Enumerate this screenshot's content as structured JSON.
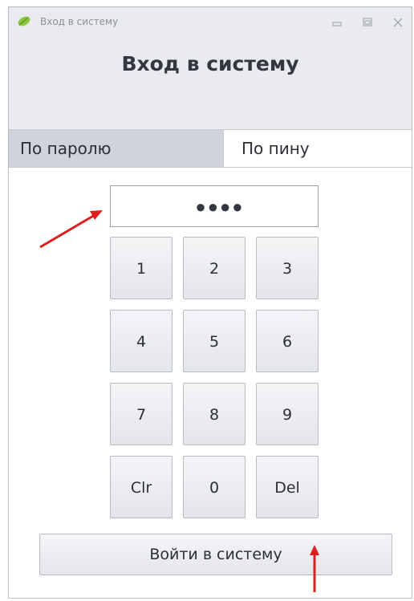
{
  "window": {
    "title": "Вход в систему"
  },
  "header": {
    "title": "Вход в систему"
  },
  "tabs": [
    {
      "label": "По паролю",
      "selected": true
    },
    {
      "label": "По пину",
      "selected": false
    }
  ],
  "pin_field": {
    "value": "●●●●"
  },
  "keypad": {
    "keys": [
      "1",
      "2",
      "3",
      "4",
      "5",
      "6",
      "7",
      "8",
      "9",
      "Clr",
      "0",
      "Del"
    ]
  },
  "login_button": {
    "label": "Войти в систему"
  },
  "annotation_color": "#e01e1e",
  "icons": [
    "leaf-icon",
    "minimize-icon",
    "maximize-icon",
    "close-icon",
    "annotation-arrow-icon"
  ]
}
